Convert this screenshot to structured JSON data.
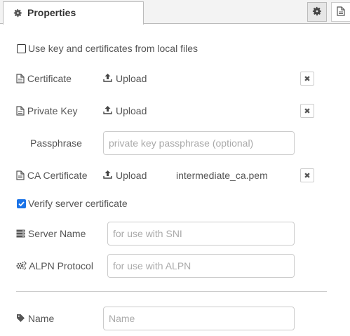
{
  "tab": {
    "label": "Properties",
    "icon": "gear-icon"
  },
  "toolbar": {
    "buttons": [
      {
        "icon": "gear-icon",
        "active": true
      },
      {
        "icon": "document-icon",
        "active": false
      }
    ]
  },
  "use_local_files": {
    "label": "Use key and certificates from local files",
    "checked": false
  },
  "certificate": {
    "label": "Certificate",
    "upload_label": "Upload",
    "file": ""
  },
  "private_key": {
    "label": "Private Key",
    "upload_label": "Upload",
    "file": ""
  },
  "passphrase": {
    "label": "Passphrase",
    "placeholder": "private key passphrase (optional)",
    "value": ""
  },
  "ca_certificate": {
    "label": "CA Certificate",
    "upload_label": "Upload",
    "file": "intermediate_ca.pem"
  },
  "verify_server": {
    "label": "Verify server certificate",
    "checked": true
  },
  "server_name": {
    "label": "Server Name",
    "placeholder": "for use with SNI",
    "value": ""
  },
  "alpn_protocol": {
    "label": "ALPN Protocol",
    "placeholder": "for use with ALPN",
    "value": ""
  },
  "name": {
    "label": "Name",
    "placeholder": "Name",
    "value": ""
  },
  "colors": {
    "checkbox_checked": "#1a73e8",
    "text": "#555555",
    "border": "#cccccc"
  }
}
